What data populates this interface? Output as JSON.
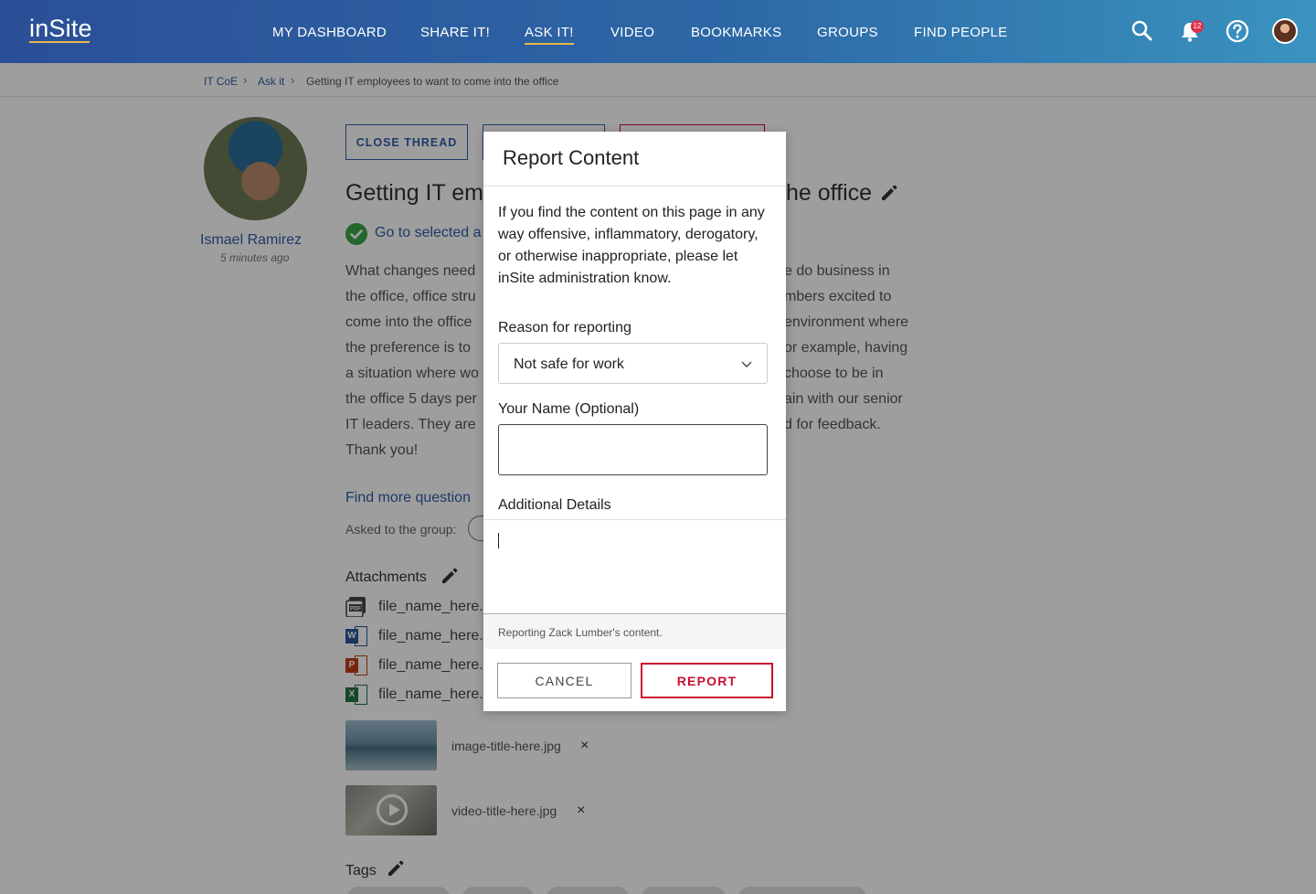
{
  "header": {
    "logo": "inSite",
    "nav": [
      {
        "label": "MY DASHBOARD",
        "active": false
      },
      {
        "label": "SHARE IT!",
        "active": false
      },
      {
        "label": "ASK IT!",
        "active": true
      },
      {
        "label": "VIDEO",
        "active": false
      },
      {
        "label": "BOOKMARKS",
        "active": false
      },
      {
        "label": "GROUPS",
        "active": false
      },
      {
        "label": "FIND PEOPLE",
        "active": false
      }
    ],
    "notification_count": "12",
    "icons": [
      "search-icon",
      "bell-icon",
      "help-icon"
    ]
  },
  "breadcrumb": {
    "items": [
      "IT CoE",
      "Ask it"
    ],
    "current": "Getting IT employees to want to come into the office"
  },
  "post": {
    "author": "Ismael Ramirez",
    "time": "5 minutes ago",
    "buttons": {
      "close_thread": "CLOSE THREAD"
    },
    "title_left": "Getting IT emp",
    "title_right": "he office",
    "go_to_answer": "Go to selected a",
    "body_left": [
      "What changes need",
      "the office, office stru",
      "come into the office",
      "the preference is to",
      "a situation where wo",
      "the office 5 days per",
      "IT leaders. They are",
      "Thank you!"
    ],
    "body_right": [
      "e do business in",
      "mbers excited to",
      "environment where",
      "or example, having",
      " choose to be in",
      "ain with our senior",
      "d for feedback.",
      ""
    ],
    "find_more": "Find more question",
    "asked_to_group": "Asked to the group:",
    "attachments_title": "Attachments",
    "files": [
      {
        "type": "PDF",
        "name": "file_name_here."
      },
      {
        "type": "W",
        "name": "file_name_here."
      },
      {
        "type": "P",
        "name": "file_name_here."
      },
      {
        "type": "X",
        "name": "file_name_here."
      }
    ],
    "media": [
      {
        "kind": "image",
        "name": "image-title-here.jpg"
      },
      {
        "kind": "video",
        "name": "video-title-here.jpg"
      }
    ],
    "remove_symbol": "×",
    "tags_title": "Tags"
  },
  "modal": {
    "title": "Report Content",
    "description": "If you find the content on this page in any way offensive, inflammatory, derogatory, or otherwise inappropriate, please let inSite administration know.",
    "reason_label": "Reason for reporting",
    "reason_value": "Not safe for work",
    "name_label": "Your Name (Optional)",
    "name_value": "",
    "details_label": "Additional Details",
    "helper": "Reporting Zack Lumber's content.",
    "cancel": "CANCEL",
    "report": "REPORT"
  },
  "colors": {
    "header_start": "#2b4f97",
    "header_end": "#3a93bf",
    "link_blue": "#2f5ea8",
    "report_red": "#c8102e",
    "accent_gold": "#e6b84a"
  }
}
